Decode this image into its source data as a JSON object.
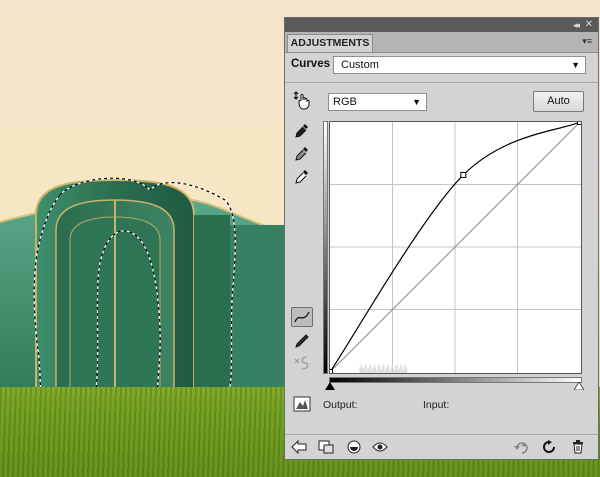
{
  "panel": {
    "tab_label": "ADJUSTMENTS",
    "adjustment_name": "Curves",
    "preset_value": "Custom",
    "channel_value": "RGB",
    "auto_label": "Auto",
    "output_label": "Output:",
    "input_label": "Input:",
    "collapse_glyph": "◂◂",
    "close_glyph": "✕",
    "menu_glyph": "▾≡",
    "dropdown_glyph": "▼"
  },
  "curve": {
    "points_input_output": [
      [
        0,
        0
      ],
      [
        136,
        201
      ],
      [
        255,
        255
      ]
    ],
    "grid_divisions": 4,
    "line_color": "#000000",
    "baseline_color": "#8c8c8c"
  },
  "colors": {
    "panel_bg": "#d3d3d3",
    "titlebar": "#5a5a5a",
    "sky": "#f4e3c8",
    "grass": "#6f9a1f",
    "building": "#3f8f6a"
  }
}
